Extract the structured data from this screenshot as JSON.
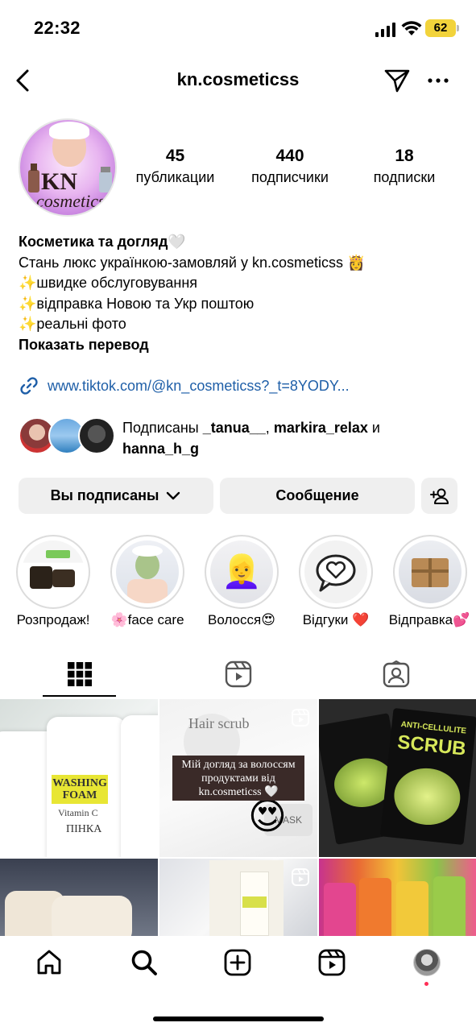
{
  "status_bar": {
    "time": "22:32",
    "battery": "62"
  },
  "header": {
    "username": "kn.cosmeticss"
  },
  "stats": [
    {
      "value": "45",
      "label": "публикации"
    },
    {
      "value": "440",
      "label": "подписчики"
    },
    {
      "value": "18",
      "label": "подписки"
    }
  ],
  "bio": {
    "name": "Косметика та догляд🤍",
    "lines": [
      "Стань люкс українкою-замовляй у kn.cosmeticss 👸",
      "✨швидке обслуговування",
      "✨відправка Новою та Укр поштою",
      "✨реальні фото"
    ],
    "translate": "Показать перевод",
    "link": "www.tiktok.com/@kn_cosmeticss?_t=8YODY..."
  },
  "followed_by": {
    "prefix": "Подписаны ",
    "user1": "_tanua__",
    "sep": ", ",
    "user2": "markira_relax",
    "conj": " и",
    "user3": "hanna_h_g"
  },
  "actions": {
    "following": "Вы подписаны",
    "message": "Сообщение"
  },
  "highlights": [
    {
      "label": "Розпродаж!"
    },
    {
      "label": "🌸face care"
    },
    {
      "label": "Волосся😍"
    },
    {
      "label": "Відгуки ❤️"
    },
    {
      "label": "Відправка💕"
    }
  ],
  "posts": {
    "p1_label1": "WASHING FOAM",
    "p1_label2": "Vitamin C",
    "p1_label3": "ПІНКА",
    "p2_overlay": "Мій догляд за волоссям продуктами від kn.cosmeticss 🤍",
    "p2_scrub": "Hair scrub",
    "p2_mask": "MASK",
    "p3_top": "ANTI-CELLULITE",
    "p3_main": "SCRUB"
  }
}
